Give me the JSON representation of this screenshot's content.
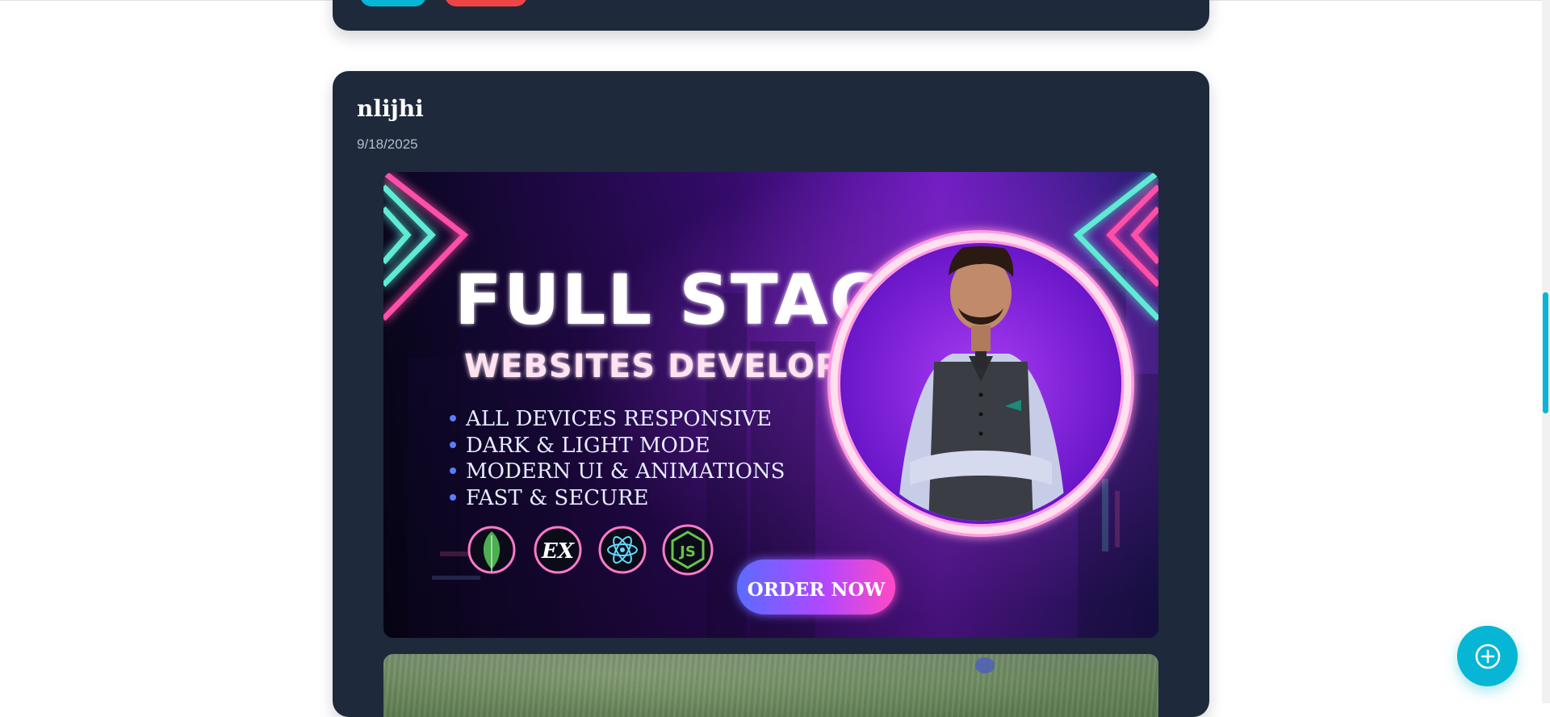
{
  "post": {
    "author": "nlijhi",
    "date": "9/18/2025"
  },
  "banner": {
    "title": "FULL STACK",
    "subtitle": "WEBSITES DEVELOPER",
    "features": [
      "ALL DEVICES RESPONSIVE",
      "DARK & LIGHT MODE",
      "MODERN UI & ANIMATIONS",
      "FAST & SECURE"
    ],
    "tech_icons": [
      "mongodb-leaf-icon",
      "express-icon",
      "react-atom-icon",
      "nodejs-icon"
    ],
    "tech_texts": {
      "express": "EX",
      "node": "JS"
    },
    "cta": "ORDER NOW"
  },
  "fab": {
    "icon": "plus-circle-icon"
  },
  "colors": {
    "card_bg": "#1e293b",
    "accent": "#06b6d4",
    "danger": "#ef4444",
    "neon_pink": "#ff4fa8",
    "neon_teal": "#5eead4"
  }
}
